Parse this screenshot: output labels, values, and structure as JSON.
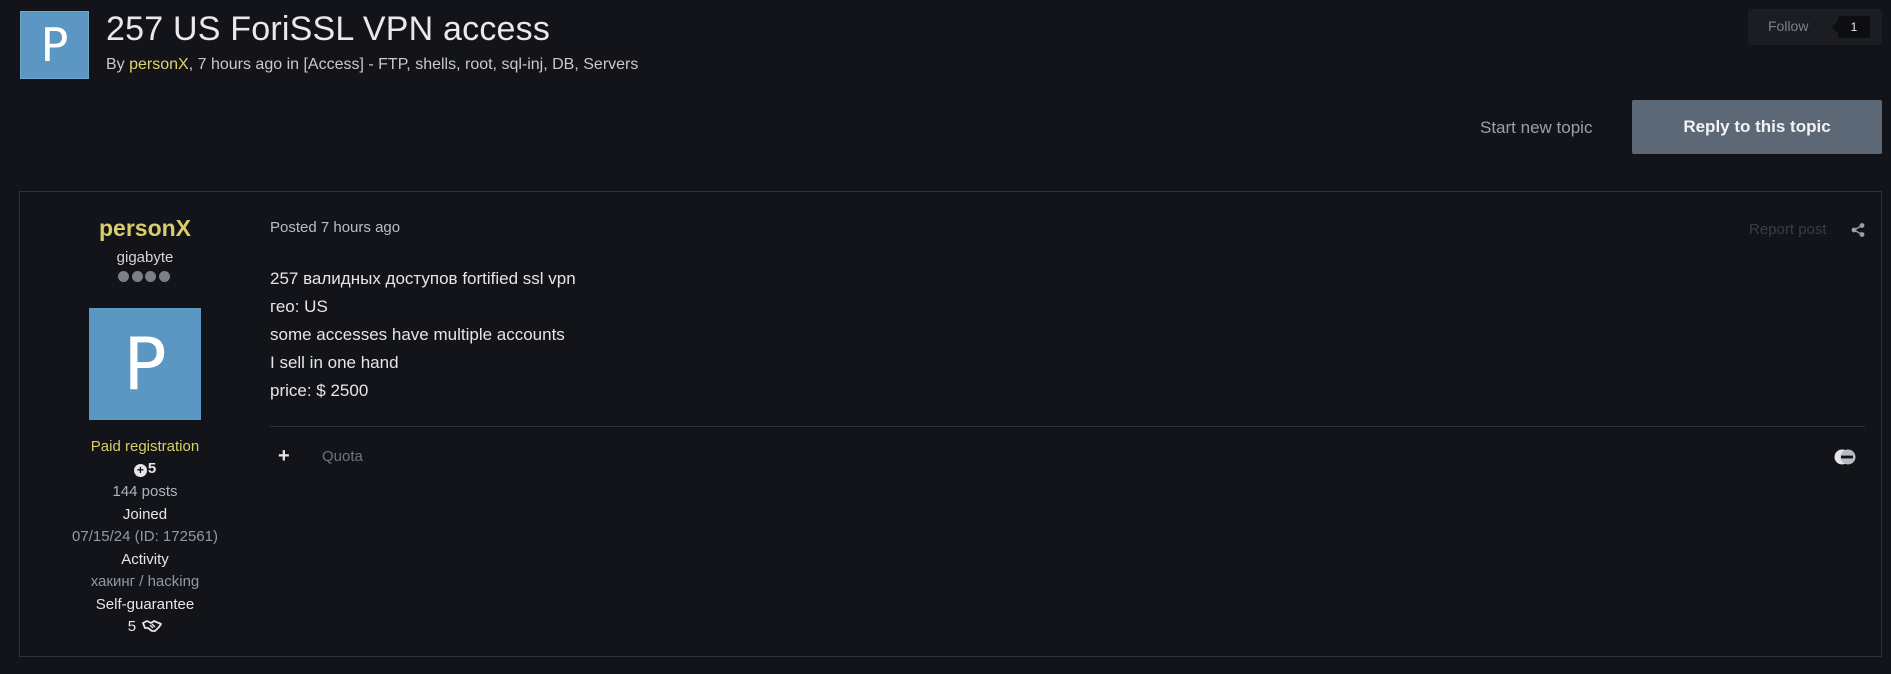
{
  "header": {
    "avatar_letter": "P",
    "title": "257 US ForiSSL VPN access",
    "byline_prefix": "By ",
    "byline_author": "personX",
    "byline_suffix": ", 7 hours ago in [Access] - FTP, shells, root, sql-inj, DB, Servers",
    "follow_label": "Follow",
    "follow_count": "1"
  },
  "actions": {
    "start_new_topic": "Start new topic",
    "reply": "Reply to this topic"
  },
  "author": {
    "name": "personX",
    "title": "gigabyte",
    "rank_pips": 4,
    "avatar_letter": "P",
    "group": "Paid registration",
    "reputation": "5",
    "posts": "144 posts",
    "joined_label": "Joined",
    "joined_value": "07/15/24 (ID: 172561)",
    "activity_label": "Activity",
    "activity_value": "хакинг / hacking",
    "guarantee_label": "Self-guarantee",
    "guarantee_value": "5"
  },
  "post": {
    "posted": "Posted 7 hours ago",
    "report": "Report post",
    "lines": [
      "257 валидных доступов fortified ssl vpn",
      "гео: US",
      "some accesses have multiple accounts",
      "I sell in one hand",
      "price: $ 2500"
    ],
    "multiquote_icon": "plus-icon",
    "quote_label": "Quota"
  },
  "colors": {
    "background": "#121419",
    "author_accent": "#d8cd6a",
    "reply_button": "#5c6876",
    "avatar": "#5b97c2"
  }
}
